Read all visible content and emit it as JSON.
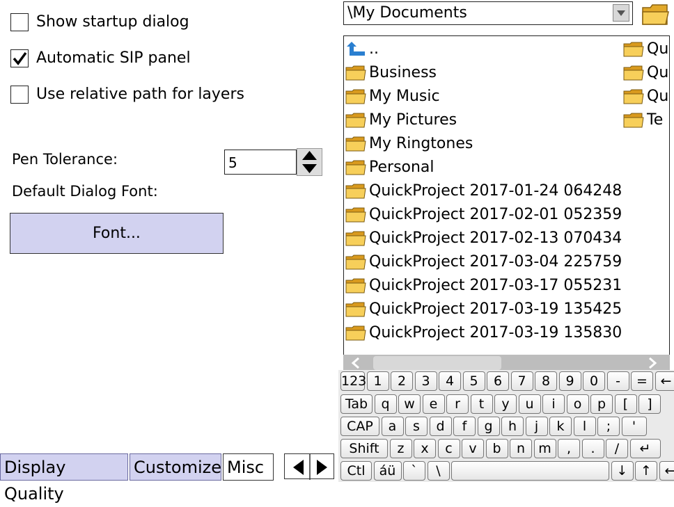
{
  "options": {
    "show_startup_dialog": {
      "label": "Show startup dialog",
      "checked": false
    },
    "automatic_sip_panel": {
      "label": "Automatic SIP panel",
      "checked": true
    },
    "relative_path_layers": {
      "label": "Use relative path for layers",
      "checked": false
    }
  },
  "pen_tolerance": {
    "label": "Pen Tolerance:",
    "value": "5"
  },
  "default_dialog_font": {
    "label": "Default Dialog Font:",
    "button": "Font..."
  },
  "tabs": [
    {
      "label": "Display Quality",
      "active": false
    },
    {
      "label": "Customize",
      "active": false
    },
    {
      "label": "Misc",
      "active": true
    }
  ],
  "file_browser": {
    "path": "\\My Documents",
    "items_col1": [
      "..",
      "Business",
      "My Music",
      "My Pictures",
      "My Ringtones",
      "Personal",
      "QuickProject 2017-01-24 064248",
      "QuickProject 2017-02-01 052359",
      "QuickProject 2017-02-13 070434",
      "QuickProject 2017-03-04 225759",
      "QuickProject 2017-03-17 055231",
      "QuickProject 2017-03-19 135425",
      "QuickProject 2017-03-19 135830"
    ],
    "items_col2": [
      "Qu",
      "Qu",
      "Qu",
      "Te"
    ]
  },
  "keyboard": {
    "row1": [
      "123",
      "1",
      "2",
      "3",
      "4",
      "5",
      "6",
      "7",
      "8",
      "9",
      "0",
      "-",
      "=",
      "←"
    ],
    "row2": [
      "Tab",
      "q",
      "w",
      "e",
      "r",
      "t",
      "y",
      "u",
      "i",
      "o",
      "p",
      "[",
      "]"
    ],
    "row3": [
      "CAP",
      "a",
      "s",
      "d",
      "f",
      "g",
      "h",
      "j",
      "k",
      "l",
      ";",
      "'"
    ],
    "row4": [
      "Shift",
      "z",
      "x",
      "c",
      "v",
      "b",
      "n",
      "m",
      ",",
      ".",
      "/",
      "↵"
    ],
    "row5": [
      "Ctl",
      "áü",
      "`",
      "\\",
      "",
      "↓",
      "↑",
      "←",
      "→"
    ]
  },
  "colors": {
    "tab_bg": "#d2d2f0",
    "button_bg": "#d2d2f0",
    "folder": "#f5c542"
  }
}
